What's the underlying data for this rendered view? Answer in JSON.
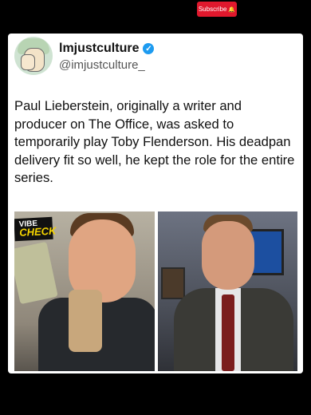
{
  "header": {
    "subscribe_label": "Subscribe",
    "subscribe_icon": "bell-icon",
    "brand_color": "#e0182d"
  },
  "post": {
    "display_name": "lmjustculture",
    "handle": "@imjustculture_",
    "verified_color": "#1d9bf0",
    "text": "Paul Lieberstein, originally a writer and producer on The Office, was asked to temporarily play Toby Flenderson. His deadpan delivery fit so well, he kept the role for the entire series."
  },
  "images": {
    "left": {
      "sticker_line1": "VIBE",
      "sticker_line2": "CHECK"
    }
  }
}
